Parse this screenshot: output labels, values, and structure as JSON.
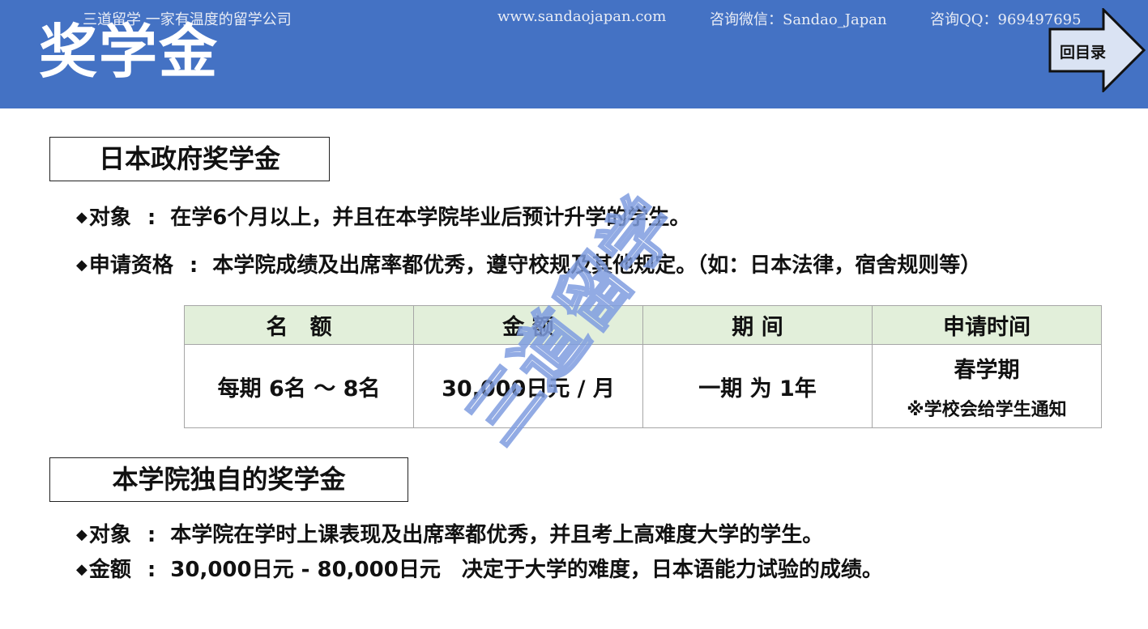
{
  "header": {
    "slogan": "三道留学  一家有温度的留学公司",
    "website": "www.sandaojapan.com",
    "wechat": "咨询微信：Sandao_Japan",
    "qq": "咨询QQ：969497695",
    "title": "奖学金",
    "back_button_label": "回目录"
  },
  "sections": [
    {
      "heading": "日本政府奖学金",
      "bullets": [
        {
          "label": "对象",
          "text": "在学6个月以上，并且在本学院毕业后预计升学的学生。"
        },
        {
          "label": "申请资格",
          "text": "本学院成绩及出席率都优秀，遵守校规及其他规定。（如：日本法律，宿舍规则等）"
        }
      ],
      "table": {
        "headers": [
          "名　额",
          "金 额",
          "期 间",
          "申请时间"
        ],
        "row": [
          "每期 6名 ～ 8名",
          "30,000日元 / 月",
          "一期 为 1年",
          "春学期"
        ],
        "note": "※学校会给学生通知"
      }
    },
    {
      "heading": "本学院独自的奖学金",
      "bullets": [
        {
          "label": "对象",
          "text": "本学院在学时上课表现及出席率都优秀，并且考上高难度大学的学生。"
        },
        {
          "label": "金额",
          "text": "30,000日元 - 80,000日元　决定于大学的难度，日本语能力试验的成绩。"
        }
      ]
    }
  ],
  "watermark": {
    "text": "三道留学",
    "color": "#7f9de0"
  },
  "colors": {
    "header_bg": "#4472c4",
    "table_header_bg": "#e2efda",
    "button_fill": "#dae3f3"
  }
}
